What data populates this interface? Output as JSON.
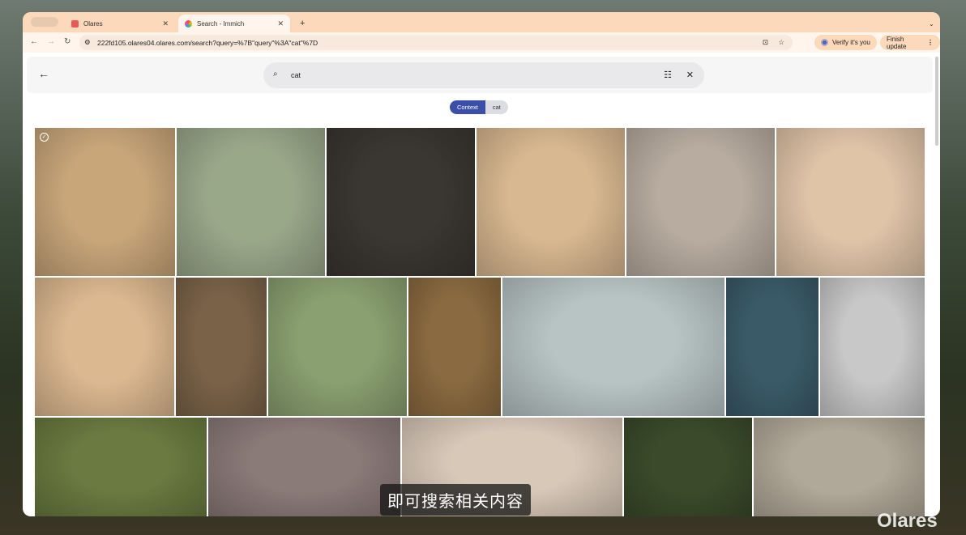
{
  "browser": {
    "tabs": [
      {
        "label": "Olares",
        "close": "✕"
      },
      {
        "label": "Search - Immich",
        "close": "✕"
      }
    ],
    "new_tab": "+",
    "url": "222fd105.olares04.olares.com/search?query=%7B\"query\"%3A\"cat\"%7D",
    "verify": "Verify it's you",
    "finish_update": "Finish update"
  },
  "search": {
    "query": "cat"
  },
  "chips": {
    "type": "Context",
    "value": "cat"
  },
  "photos": [
    {
      "color": "#c9a67a"
    },
    {
      "color": "#9aa88a"
    },
    {
      "color": "#3a3632"
    },
    {
      "color": "#d8b890"
    },
    {
      "color": "#b8aca0"
    },
    {
      "color": "#e0c4a8"
    },
    {
      "color": "#dcb890"
    },
    {
      "color": "#7a6248"
    },
    {
      "color": "#8aa070"
    },
    {
      "color": "#8a6a40"
    },
    {
      "color": "#b8c4c4"
    },
    {
      "color": "#3a5a68"
    },
    {
      "color": "#c8c8c8"
    },
    {
      "color": "#6a7a40"
    },
    {
      "color": "#8a7a78"
    },
    {
      "color": "#d8c8b8"
    },
    {
      "color": "#3a4a2a"
    },
    {
      "color": "#b0a898"
    }
  ],
  "subtitle": "即可搜索相关内容",
  "watermark": "Olares"
}
